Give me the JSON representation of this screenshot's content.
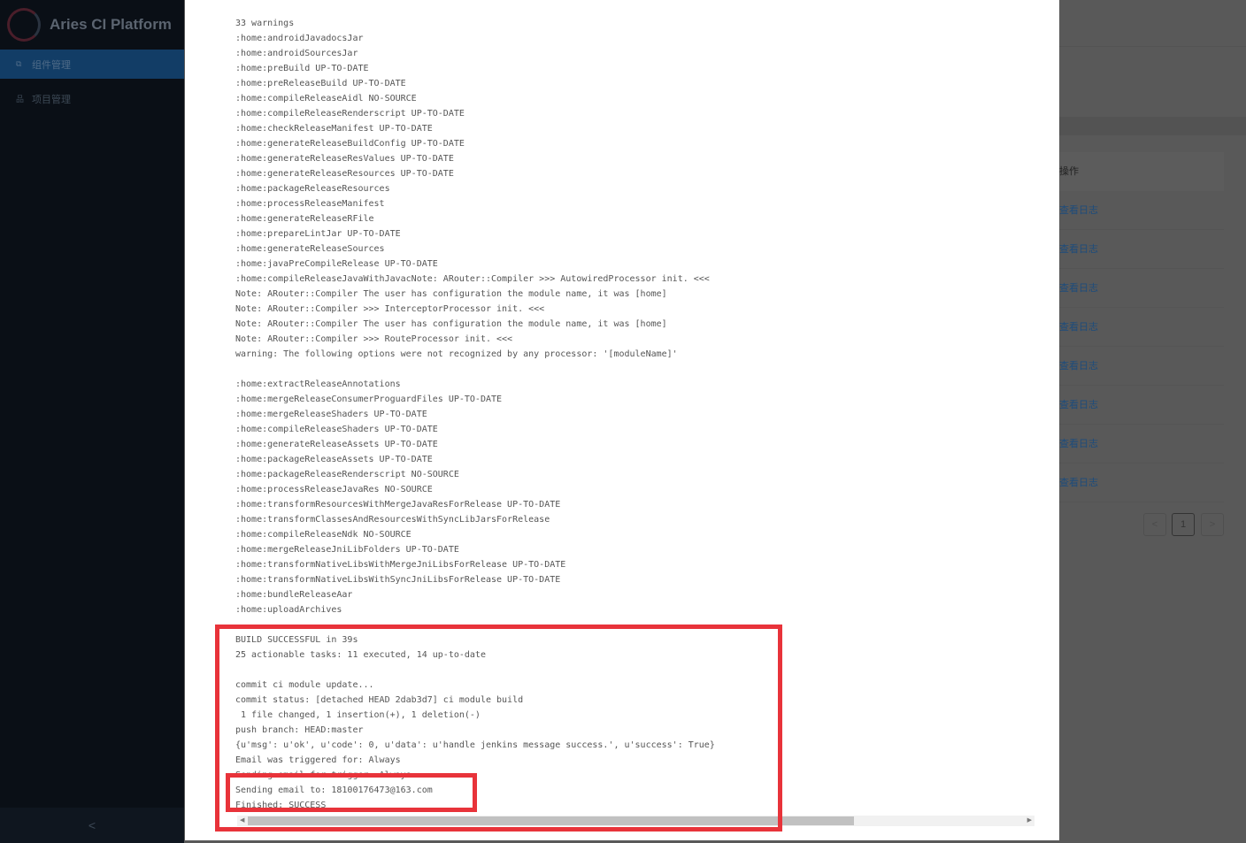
{
  "app": {
    "title": "Aries CI Platform"
  },
  "sidebar": {
    "items": [
      {
        "label": "组件管理",
        "icon": "component-icon",
        "active": true
      },
      {
        "label": "项目管理",
        "icon": "project-icon",
        "active": false
      }
    ],
    "collapse_label": "<"
  },
  "background": {
    "column_header": "操作",
    "row_action": "查看日志",
    "rows": 8,
    "pagination": {
      "prev": "<",
      "current": "1",
      "next": ">"
    }
  },
  "log": {
    "lines": [
      "33 warnings",
      ":home:androidJavadocsJar",
      ":home:androidSourcesJar",
      ":home:preBuild UP-TO-DATE",
      ":home:preReleaseBuild UP-TO-DATE",
      ":home:compileReleaseAidl NO-SOURCE",
      ":home:compileReleaseRenderscript UP-TO-DATE",
      ":home:checkReleaseManifest UP-TO-DATE",
      ":home:generateReleaseBuildConfig UP-TO-DATE",
      ":home:generateReleaseResValues UP-TO-DATE",
      ":home:generateReleaseResources UP-TO-DATE",
      ":home:packageReleaseResources",
      ":home:processReleaseManifest",
      ":home:generateReleaseRFile",
      ":home:prepareLintJar UP-TO-DATE",
      ":home:generateReleaseSources",
      ":home:javaPreCompileRelease UP-TO-DATE",
      ":home:compileReleaseJavaWithJavacNote: ARouter::Compiler >>> AutowiredProcessor init. <<<",
      "Note: ARouter::Compiler The user has configuration the module name, it was [home]",
      "Note: ARouter::Compiler >>> InterceptorProcessor init. <<<",
      "Note: ARouter::Compiler The user has configuration the module name, it was [home]",
      "Note: ARouter::Compiler >>> RouteProcessor init. <<<",
      "warning: The following options were not recognized by any processor: '[moduleName]'",
      "",
      ":home:extractReleaseAnnotations",
      ":home:mergeReleaseConsumerProguardFiles UP-TO-DATE",
      ":home:mergeReleaseShaders UP-TO-DATE",
      ":home:compileReleaseShaders UP-TO-DATE",
      ":home:generateReleaseAssets UP-TO-DATE",
      ":home:packageReleaseAssets UP-TO-DATE",
      ":home:packageReleaseRenderscript NO-SOURCE",
      ":home:processReleaseJavaRes NO-SOURCE",
      ":home:transformResourcesWithMergeJavaResForRelease UP-TO-DATE",
      ":home:transformClassesAndResourcesWithSyncLibJarsForRelease",
      ":home:compileReleaseNdk NO-SOURCE",
      ":home:mergeReleaseJniLibFolders UP-TO-DATE",
      ":home:transformNativeLibsWithMergeJniLibsForRelease UP-TO-DATE",
      ":home:transformNativeLibsWithSyncJniLibsForRelease UP-TO-DATE",
      ":home:bundleReleaseAar",
      ":home:uploadArchives",
      "",
      "BUILD SUCCESSFUL in 39s",
      "25 actionable tasks: 11 executed, 14 up-to-date",
      "",
      "commit ci module update...",
      "commit status: [detached HEAD 2dab3d7] ci module build",
      " 1 file changed, 1 insertion(+), 1 deletion(-)",
      "push branch: HEAD:master",
      "{u'msg': u'ok', u'code': 0, u'data': u'handle jenkins message success.', u'success': True}",
      "Email was triggered for: Always",
      "Sending email for trigger: Always",
      "Sending email to: 18100176473@163.com",
      "Finished: SUCCESS"
    ]
  },
  "colors": {
    "highlight": "#e8333a",
    "sidebar_active": "#123d66",
    "link": "#1890ff"
  }
}
